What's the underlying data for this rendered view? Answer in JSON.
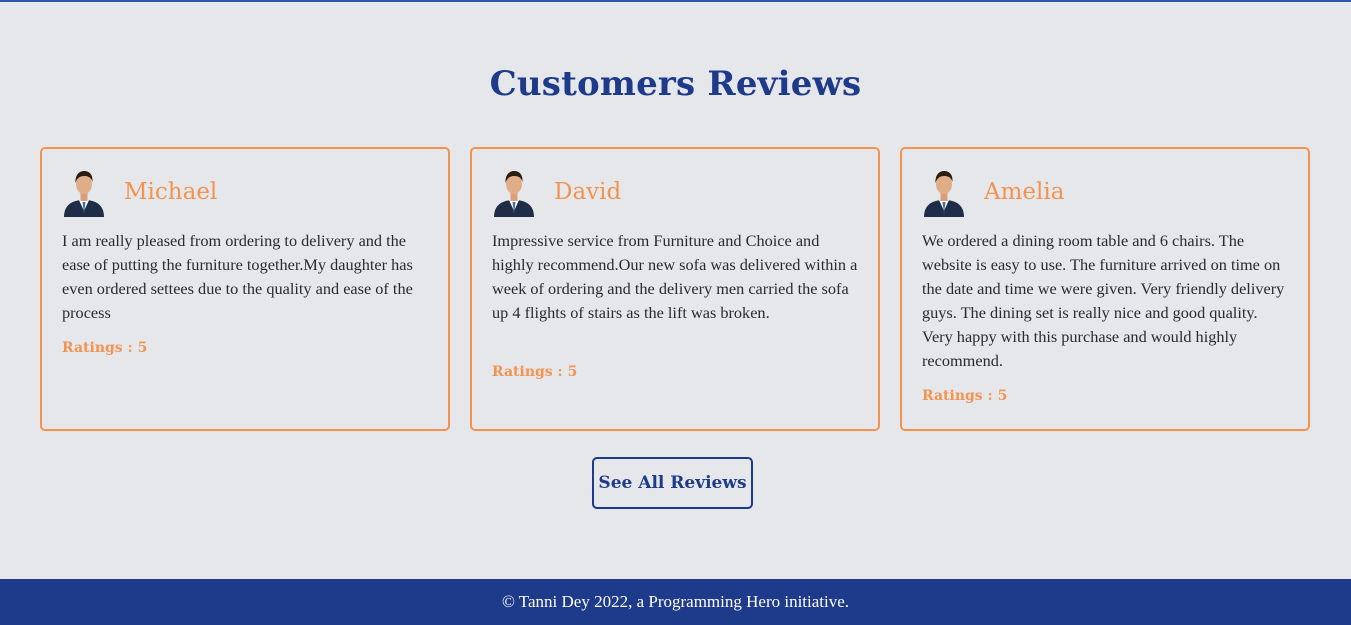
{
  "section": {
    "title": "Customers Reviews"
  },
  "reviews": [
    {
      "name": "Michael",
      "text": "I am really pleased from ordering to delivery and the ease of putting the furniture together.My daughter has even ordered settees due to the quality and ease of the process",
      "rating": "Ratings : 5"
    },
    {
      "name": "David",
      "text": "Impressive service from Furniture and Choice and highly recommend.Our new sofa was delivered within a week of ordering and the delivery men carried the sofa up 4 flights of stairs as the lift was broken.",
      "rating": "Ratings : 5"
    },
    {
      "name": "Amelia",
      "text": "We ordered a dining room table and 6 chairs. The website is easy to use. The furniture arrived on time on the date and time we were given. Very friendly delivery guys. The dining set is really nice and good quality. Very happy with this purchase and would highly recommend.",
      "rating": "Ratings : 5"
    }
  ],
  "see_all_label": "See All Reviews",
  "footer": {
    "text": "© Tanni Dey 2022, a Programming Hero initiative."
  },
  "colors": {
    "background": "#e6e7eb",
    "primary": "#1e3a8a",
    "accent": "#f49350",
    "text": "#2a2a2a"
  },
  "icons": {
    "avatar": "businessman-avatar-icon"
  }
}
